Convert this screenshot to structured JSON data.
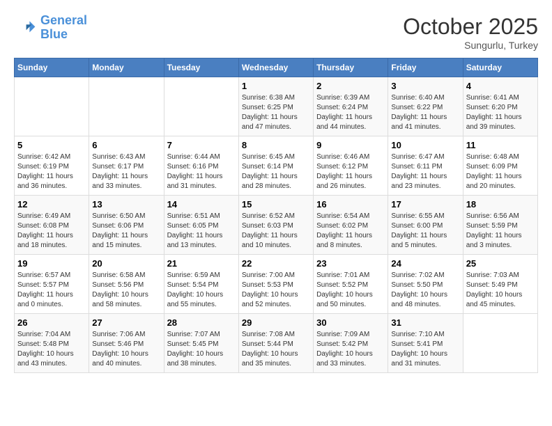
{
  "header": {
    "logo_line1": "General",
    "logo_line2": "Blue",
    "month": "October 2025",
    "location": "Sungurlu, Turkey"
  },
  "weekdays": [
    "Sunday",
    "Monday",
    "Tuesday",
    "Wednesday",
    "Thursday",
    "Friday",
    "Saturday"
  ],
  "weeks": [
    [
      {
        "day": "",
        "info": ""
      },
      {
        "day": "",
        "info": ""
      },
      {
        "day": "",
        "info": ""
      },
      {
        "day": "1",
        "info": "Sunrise: 6:38 AM\nSunset: 6:25 PM\nDaylight: 11 hours and 47 minutes."
      },
      {
        "day": "2",
        "info": "Sunrise: 6:39 AM\nSunset: 6:24 PM\nDaylight: 11 hours and 44 minutes."
      },
      {
        "day": "3",
        "info": "Sunrise: 6:40 AM\nSunset: 6:22 PM\nDaylight: 11 hours and 41 minutes."
      },
      {
        "day": "4",
        "info": "Sunrise: 6:41 AM\nSunset: 6:20 PM\nDaylight: 11 hours and 39 minutes."
      }
    ],
    [
      {
        "day": "5",
        "info": "Sunrise: 6:42 AM\nSunset: 6:19 PM\nDaylight: 11 hours and 36 minutes."
      },
      {
        "day": "6",
        "info": "Sunrise: 6:43 AM\nSunset: 6:17 PM\nDaylight: 11 hours and 33 minutes."
      },
      {
        "day": "7",
        "info": "Sunrise: 6:44 AM\nSunset: 6:16 PM\nDaylight: 11 hours and 31 minutes."
      },
      {
        "day": "8",
        "info": "Sunrise: 6:45 AM\nSunset: 6:14 PM\nDaylight: 11 hours and 28 minutes."
      },
      {
        "day": "9",
        "info": "Sunrise: 6:46 AM\nSunset: 6:12 PM\nDaylight: 11 hours and 26 minutes."
      },
      {
        "day": "10",
        "info": "Sunrise: 6:47 AM\nSunset: 6:11 PM\nDaylight: 11 hours and 23 minutes."
      },
      {
        "day": "11",
        "info": "Sunrise: 6:48 AM\nSunset: 6:09 PM\nDaylight: 11 hours and 20 minutes."
      }
    ],
    [
      {
        "day": "12",
        "info": "Sunrise: 6:49 AM\nSunset: 6:08 PM\nDaylight: 11 hours and 18 minutes."
      },
      {
        "day": "13",
        "info": "Sunrise: 6:50 AM\nSunset: 6:06 PM\nDaylight: 11 hours and 15 minutes."
      },
      {
        "day": "14",
        "info": "Sunrise: 6:51 AM\nSunset: 6:05 PM\nDaylight: 11 hours and 13 minutes."
      },
      {
        "day": "15",
        "info": "Sunrise: 6:52 AM\nSunset: 6:03 PM\nDaylight: 11 hours and 10 minutes."
      },
      {
        "day": "16",
        "info": "Sunrise: 6:54 AM\nSunset: 6:02 PM\nDaylight: 11 hours and 8 minutes."
      },
      {
        "day": "17",
        "info": "Sunrise: 6:55 AM\nSunset: 6:00 PM\nDaylight: 11 hours and 5 minutes."
      },
      {
        "day": "18",
        "info": "Sunrise: 6:56 AM\nSunset: 5:59 PM\nDaylight: 11 hours and 3 minutes."
      }
    ],
    [
      {
        "day": "19",
        "info": "Sunrise: 6:57 AM\nSunset: 5:57 PM\nDaylight: 11 hours and 0 minutes."
      },
      {
        "day": "20",
        "info": "Sunrise: 6:58 AM\nSunset: 5:56 PM\nDaylight: 10 hours and 58 minutes."
      },
      {
        "day": "21",
        "info": "Sunrise: 6:59 AM\nSunset: 5:54 PM\nDaylight: 10 hours and 55 minutes."
      },
      {
        "day": "22",
        "info": "Sunrise: 7:00 AM\nSunset: 5:53 PM\nDaylight: 10 hours and 52 minutes."
      },
      {
        "day": "23",
        "info": "Sunrise: 7:01 AM\nSunset: 5:52 PM\nDaylight: 10 hours and 50 minutes."
      },
      {
        "day": "24",
        "info": "Sunrise: 7:02 AM\nSunset: 5:50 PM\nDaylight: 10 hours and 48 minutes."
      },
      {
        "day": "25",
        "info": "Sunrise: 7:03 AM\nSunset: 5:49 PM\nDaylight: 10 hours and 45 minutes."
      }
    ],
    [
      {
        "day": "26",
        "info": "Sunrise: 7:04 AM\nSunset: 5:48 PM\nDaylight: 10 hours and 43 minutes."
      },
      {
        "day": "27",
        "info": "Sunrise: 7:06 AM\nSunset: 5:46 PM\nDaylight: 10 hours and 40 minutes."
      },
      {
        "day": "28",
        "info": "Sunrise: 7:07 AM\nSunset: 5:45 PM\nDaylight: 10 hours and 38 minutes."
      },
      {
        "day": "29",
        "info": "Sunrise: 7:08 AM\nSunset: 5:44 PM\nDaylight: 10 hours and 35 minutes."
      },
      {
        "day": "30",
        "info": "Sunrise: 7:09 AM\nSunset: 5:42 PM\nDaylight: 10 hours and 33 minutes."
      },
      {
        "day": "31",
        "info": "Sunrise: 7:10 AM\nSunset: 5:41 PM\nDaylight: 10 hours and 31 minutes."
      },
      {
        "day": "",
        "info": ""
      }
    ]
  ]
}
